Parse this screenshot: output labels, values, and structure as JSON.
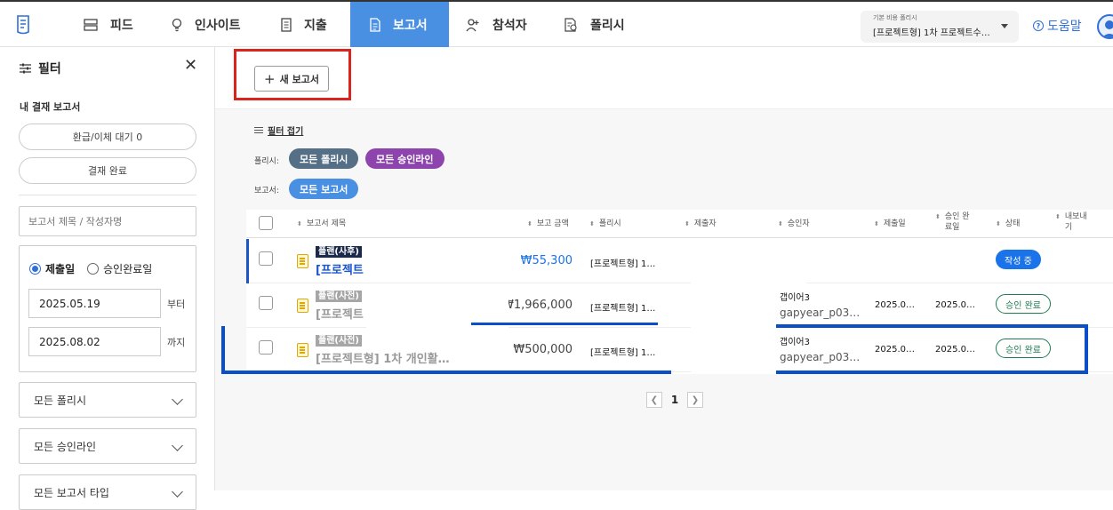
{
  "topnav": {
    "items": [
      {
        "label": "피드",
        "icon": "feed-icon"
      },
      {
        "label": "인사이트",
        "icon": "lightbulb-icon"
      },
      {
        "label": "지출",
        "icon": "receipt-icon"
      },
      {
        "label": "보고서",
        "icon": "report-icon",
        "active": true
      },
      {
        "label": "참석자",
        "icon": "person-add-icon"
      },
      {
        "label": "폴리시",
        "icon": "policy-icon"
      }
    ],
    "policy_select": {
      "label": "기본 비용 폴리시",
      "value": "[프로젝트형] 1차 프로젝트수…"
    },
    "help": "도움말",
    "accent_color": "#4a90e2"
  },
  "sidebar": {
    "title": "필터",
    "section_title": "내 결재 보고서",
    "pending_refund": "환급/이체 대기 0",
    "approved": "결재 완료",
    "search_placeholder": "보고서 제목 / 작성자명",
    "date_type": {
      "option1": "제출일",
      "option2": "승인완료일",
      "selected": "제출일"
    },
    "date_from": "2025.05.19",
    "date_from_suffix": "부터",
    "date_to": "2025.08.02",
    "date_to_suffix": "까지",
    "dropdowns": [
      "모든 폴리시",
      "모든 승인라인",
      "모든 보고서 타입"
    ]
  },
  "main": {
    "new_report": "새 보고서",
    "filter_fold": "필터 접기",
    "policy_label": "폴리시:",
    "policy_chips": [
      {
        "label": "모든 폴리시",
        "color": "#546f86"
      },
      {
        "label": "모든 승인라인",
        "color": "#8e44ad"
      }
    ],
    "report_label": "보고서:",
    "report_chips": [
      {
        "label": "모든 보고서",
        "color": "#4a90e2"
      }
    ],
    "table": {
      "headers": {
        "title": "보고서 제목",
        "amount": "보고 금액",
        "policy": "폴리시",
        "submitter": "제출자",
        "approver": "승인자",
        "submit_date": "제출일",
        "approve_date_1": "승인 완",
        "approve_date_2": "료일",
        "status": "상태",
        "export_1": "내보내",
        "export_2": "기"
      },
      "rows": [
        {
          "tag": "플랜(사후)",
          "tag_color": "#1b2a4a",
          "title": "[프로젝트",
          "amount": "₩55,300",
          "amount_color": "#1a73e8",
          "policy": "[프로젝트형] 1…",
          "approver_name": "",
          "approver_id": "",
          "submit_date": "",
          "approve_date": "",
          "status": "작성 중",
          "status_type": "draft"
        },
        {
          "tag": "플랜(사전)",
          "tag_color": "#a6a6a6",
          "title": "[프로젝트",
          "amount": "₩1,966,000",
          "amount_color": "#444444",
          "policy": "[프로젝트형] 1…",
          "approver_name": "갭이어3",
          "approver_id": "gapyear_p03…",
          "submit_date": "2025.0…",
          "approve_date": "2025.0…",
          "status": "승인 완료",
          "status_type": "done"
        },
        {
          "tag": "플랜(사전)",
          "tag_color": "#a6a6a6",
          "title": "[프로젝트형] 1차 개인활…",
          "amount": "₩500,000",
          "amount_color": "#444444",
          "policy": "[프로젝트형] 1…",
          "approver_name": "갭이어3",
          "approver_id": "gapyear_p03…",
          "submit_date": "2025.0…",
          "approve_date": "2025.0…",
          "status": "승인 완료",
          "status_type": "done"
        }
      ]
    },
    "pagination": {
      "current": "1"
    }
  }
}
